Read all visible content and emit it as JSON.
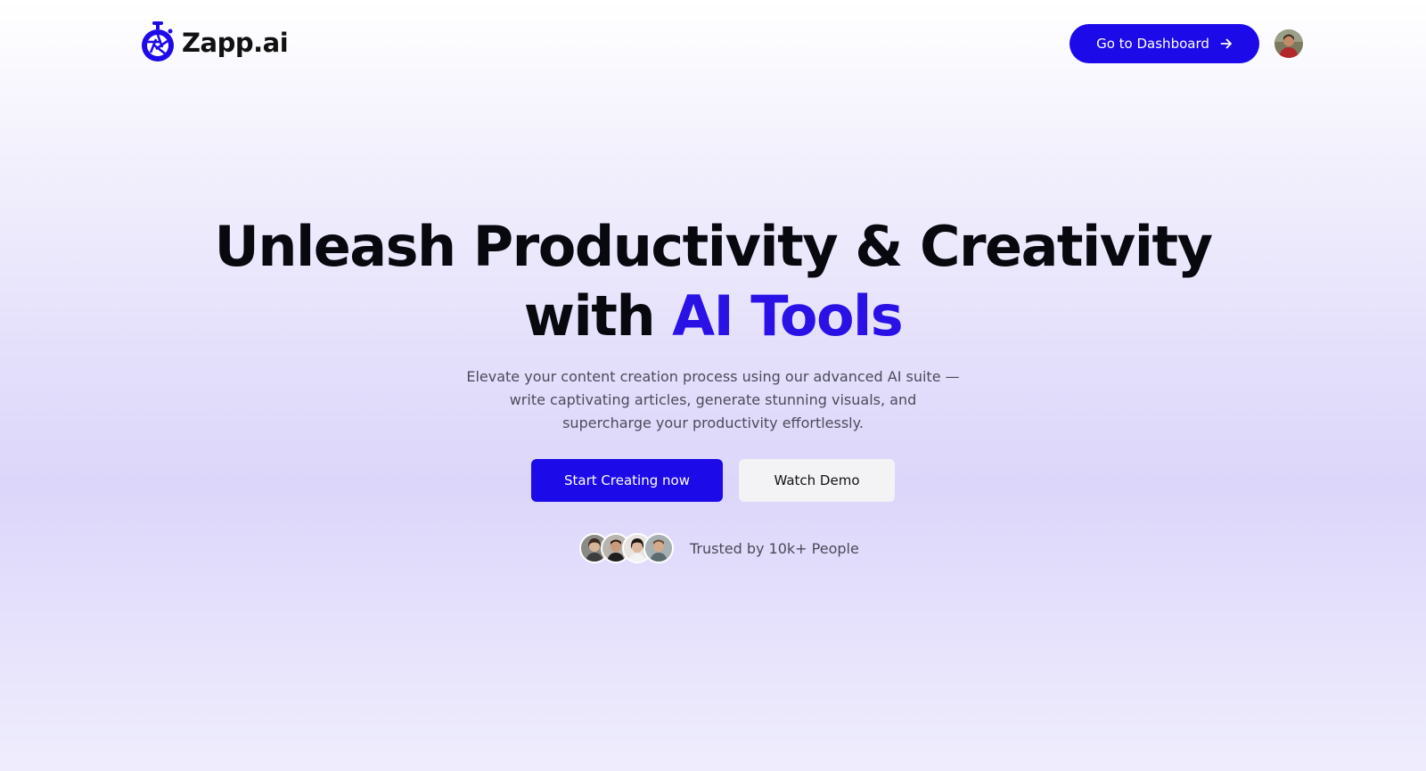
{
  "brand": {
    "name": "Zapp.ai",
    "logo_icon": "camera-aperture-icon",
    "accent_color": "#1d0ae8"
  },
  "nav": {
    "dashboard_label": "Go to Dashboard",
    "dashboard_icon": "arrow-right-icon",
    "avatar_icon": "user-avatar"
  },
  "hero": {
    "title_line1": "Unleash Productivity & Creativity",
    "title_line2_prefix": "with ",
    "title_line2_accent": "AI Tools",
    "subtitle": "Elevate your content creation process using our advanced AI suite — write captivating articles, generate stunning visuals, and supercharge your productivity effortlessly.",
    "primary_cta": "Start Creating now",
    "secondary_cta": "Watch Demo"
  },
  "trust": {
    "text": "Trusted by 10k+ People",
    "avatars": [
      "user-avatar-1",
      "user-avatar-2",
      "user-avatar-3",
      "user-avatar-4"
    ]
  },
  "colors": {
    "primary": "#1d0ae8",
    "title_accent": "#2a12e6",
    "secondary_button_bg": "#f3f3f6"
  }
}
